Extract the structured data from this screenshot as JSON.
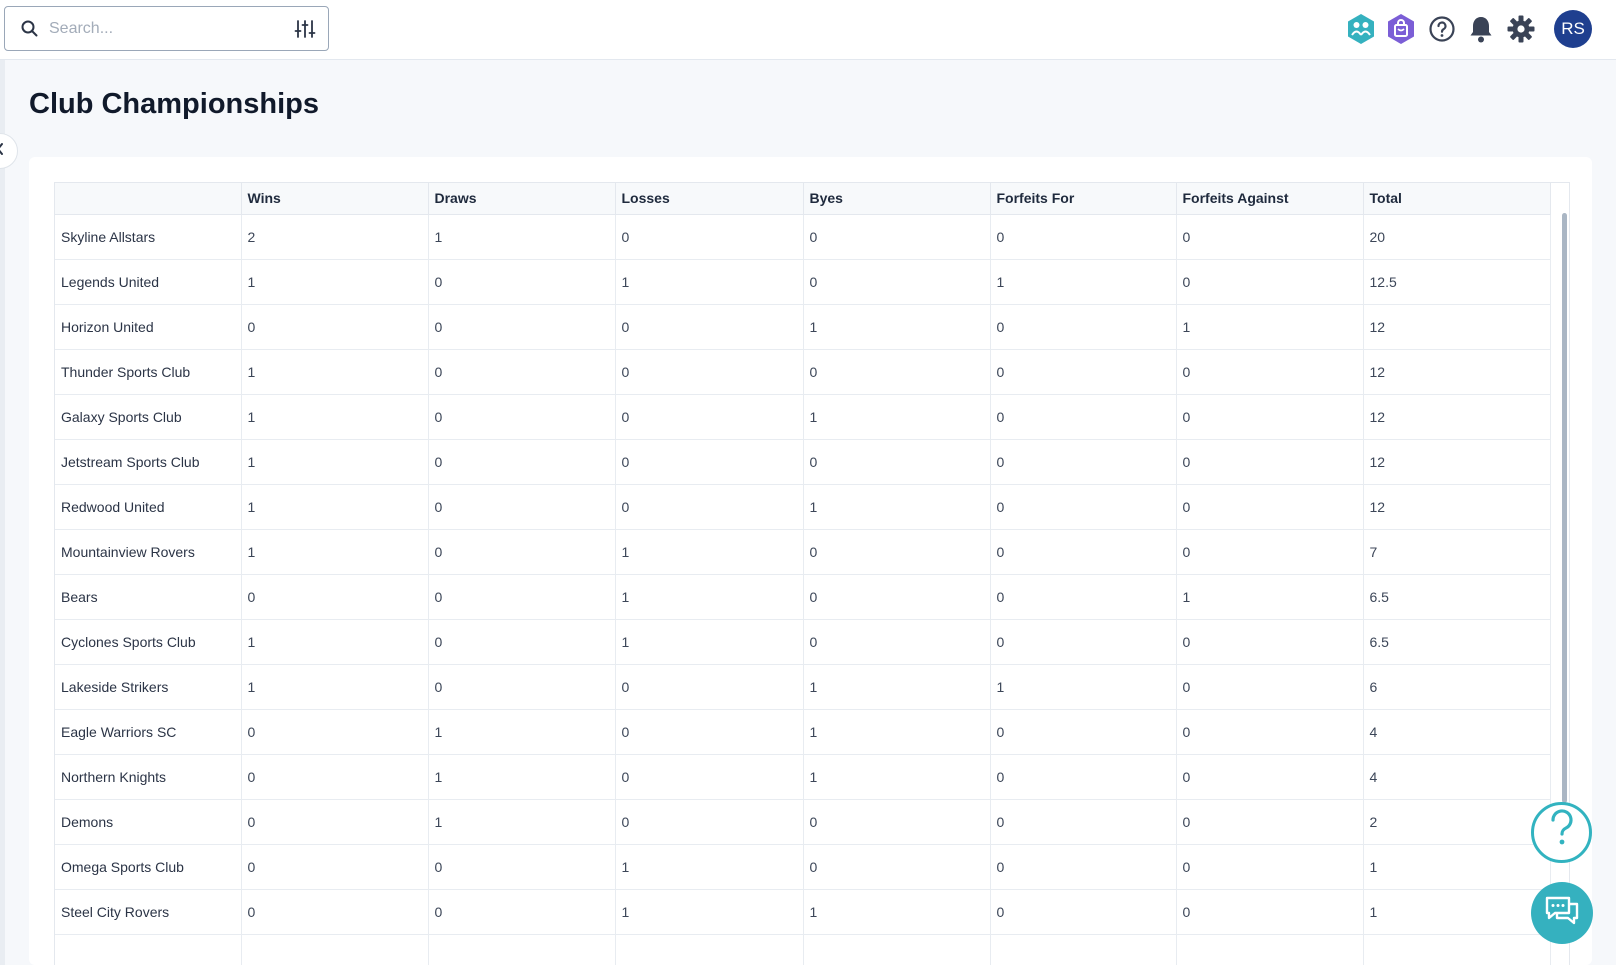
{
  "search": {
    "placeholder": "Search..."
  },
  "header": {
    "avatar_initials": "RS"
  },
  "page": {
    "title": "Club Championships"
  },
  "table": {
    "columns": [
      "",
      "Wins",
      "Draws",
      "Losses",
      "Byes",
      "Forfeits For",
      "Forfeits Against",
      "Total"
    ],
    "rows": [
      [
        "Skyline Allstars",
        "2",
        "1",
        "0",
        "0",
        "0",
        "0",
        "20"
      ],
      [
        "Legends United",
        "1",
        "0",
        "1",
        "0",
        "1",
        "0",
        "12.5"
      ],
      [
        "Horizon United",
        "0",
        "0",
        "0",
        "1",
        "0",
        "1",
        "12"
      ],
      [
        "Thunder Sports Club",
        "1",
        "0",
        "0",
        "0",
        "0",
        "0",
        "12"
      ],
      [
        "Galaxy Sports Club",
        "1",
        "0",
        "0",
        "1",
        "0",
        "0",
        "12"
      ],
      [
        "Jetstream Sports Club",
        "1",
        "0",
        "0",
        "0",
        "0",
        "0",
        "12"
      ],
      [
        "Redwood United",
        "1",
        "0",
        "0",
        "1",
        "0",
        "0",
        "12"
      ],
      [
        "Mountainview Rovers",
        "1",
        "0",
        "1",
        "0",
        "0",
        "0",
        "7"
      ],
      [
        "Bears",
        "0",
        "0",
        "1",
        "0",
        "0",
        "1",
        "6.5"
      ],
      [
        "Cyclones Sports Club",
        "1",
        "0",
        "1",
        "0",
        "0",
        "0",
        "6.5"
      ],
      [
        "Lakeside Strikers",
        "1",
        "0",
        "0",
        "1",
        "1",
        "0",
        "6"
      ],
      [
        "Eagle Warriors SC",
        "0",
        "1",
        "0",
        "1",
        "0",
        "0",
        "4"
      ],
      [
        "Northern Knights",
        "0",
        "1",
        "0",
        "1",
        "0",
        "0",
        "4"
      ],
      [
        "Demons",
        "0",
        "1",
        "0",
        "0",
        "0",
        "0",
        "2"
      ],
      [
        "Omega Sports Club",
        "0",
        "0",
        "1",
        "0",
        "0",
        "0",
        "1"
      ],
      [
        "Steel City Rovers",
        "0",
        "0",
        "1",
        "1",
        "0",
        "0",
        "1"
      ],
      [
        "",
        "",
        "",
        "",
        "",
        "",
        "",
        ""
      ]
    ]
  },
  "icons": {
    "search": "search-icon",
    "filter": "sliders-icon",
    "apps1": "people-hexagon-icon",
    "apps2": "shopping-bag-hexagon-icon",
    "help": "question-circle-icon",
    "bell": "bell-icon",
    "settings": "gear-icon",
    "help_fab": "question-mark-icon",
    "chat": "chat-bubbles-icon"
  },
  "colors": {
    "accent": "#35b1bf",
    "avatar": "#1f3f8f",
    "purple": "#7b5ed6"
  }
}
